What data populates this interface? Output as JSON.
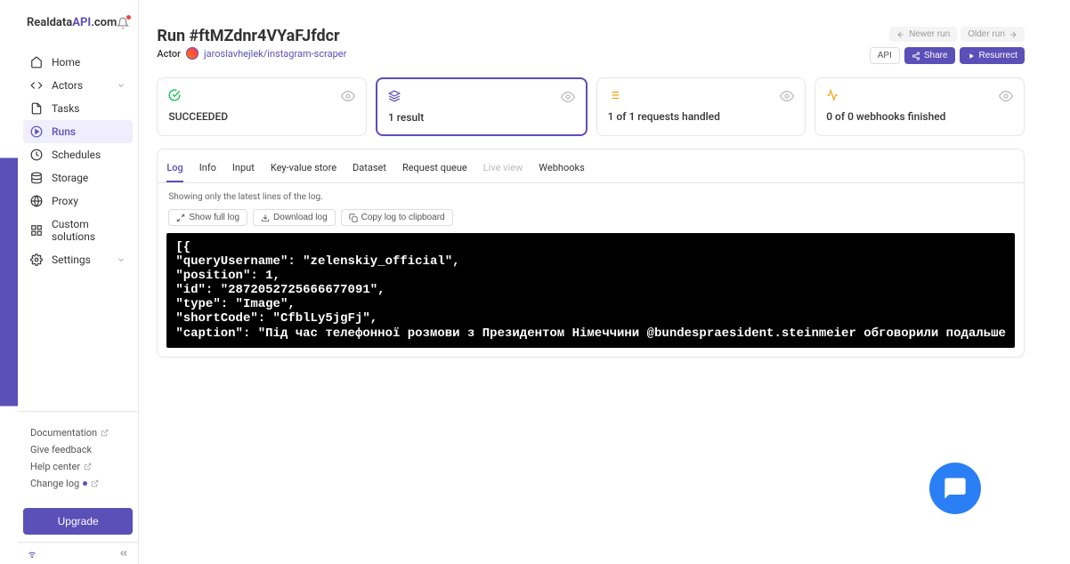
{
  "brand": {
    "pre": "Realdata",
    "mid": "API",
    "post": "com"
  },
  "sidebar": {
    "nav": [
      {
        "icon": "home",
        "label": "Home",
        "active": false,
        "chevron": false
      },
      {
        "icon": "code",
        "label": "Actors",
        "active": false,
        "chevron": true
      },
      {
        "icon": "doc",
        "label": "Tasks",
        "active": false,
        "chevron": false
      },
      {
        "icon": "play",
        "label": "Runs",
        "active": true,
        "chevron": false
      },
      {
        "icon": "clock",
        "label": "Schedules",
        "active": false,
        "chevron": false
      },
      {
        "icon": "db",
        "label": "Storage",
        "active": false,
        "chevron": false
      },
      {
        "icon": "globe",
        "label": "Proxy",
        "active": false,
        "chevron": false
      },
      {
        "icon": "puzzle",
        "label": "Custom solutions",
        "active": false,
        "chevron": false
      },
      {
        "icon": "gear",
        "label": "Settings",
        "active": false,
        "chevron": true
      }
    ],
    "footer": [
      {
        "label": "Documentation",
        "ext": true,
        "dot": false
      },
      {
        "label": "Give feedback",
        "ext": false,
        "dot": false
      },
      {
        "label": "Help center",
        "ext": true,
        "dot": false
      },
      {
        "label": "Change log",
        "ext": true,
        "dot": true
      }
    ],
    "upgrade": "Upgrade"
  },
  "header": {
    "title": "Run #ftMZdnr4VYaFJfdcr",
    "actor_label": "Actor",
    "actor_link": "jaroslavhejlek/instagram-scraper",
    "newer": "Newer run",
    "older": "Older run",
    "api": "API",
    "share": "Share",
    "resurrect": "Resurrect"
  },
  "stats": [
    {
      "icon": "check",
      "text": "SUCCEEDED",
      "color": "#22c55e"
    },
    {
      "icon": "layers",
      "text": "1 result",
      "color": "#5b4fb8"
    },
    {
      "icon": "list",
      "text": "1 of 1 requests handled",
      "color": "#f59e0b"
    },
    {
      "icon": "pulse",
      "text": "0 of 0 webhooks finished",
      "color": "#f59e0b"
    }
  ],
  "tabs": [
    {
      "label": "Log",
      "state": "active"
    },
    {
      "label": "Info",
      "state": ""
    },
    {
      "label": "Input",
      "state": ""
    },
    {
      "label": "Key-value store",
      "state": ""
    },
    {
      "label": "Dataset",
      "state": ""
    },
    {
      "label": "Request queue",
      "state": ""
    },
    {
      "label": "Live view",
      "state": "disabled"
    },
    {
      "label": "Webhooks",
      "state": ""
    }
  ],
  "log": {
    "hint": "Showing only the latest lines of the log.",
    "show_full": "Show full log",
    "download": "Download log",
    "copy": "Copy log to clipboard",
    "content": "[{\n\"queryUsername\": \"zelenskiy_official\",\n\"position\": 1,\n\"id\": \"2872052725666677091\",\n\"type\": \"Image\",\n\"shortCode\": \"CfblLy5jgFj\",\n\"caption\": \"Під час телефонної розмови з Президентом Німеччини @bundespraesident.steinmeier обговорили подальше"
  }
}
